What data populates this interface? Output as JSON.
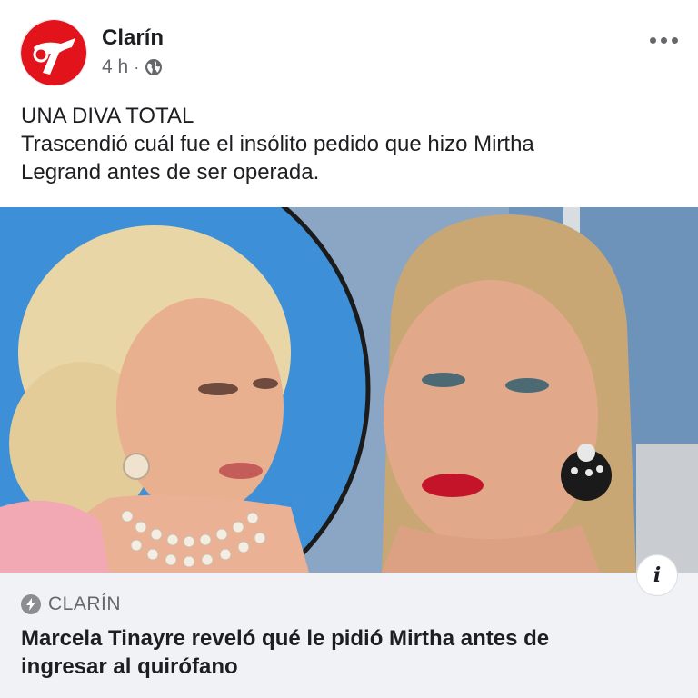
{
  "post": {
    "page_name": "Clarín",
    "time": "4 h",
    "separator": "·",
    "privacy_icon": "globe-icon",
    "more_icon": "more-options-icon",
    "text_lines": [
      "UNA DIVA TOTAL",
      "Trascendió cuál fue el insólito pedido que hizo Mirtha",
      "Legrand antes de ser operada."
    ]
  },
  "link_preview": {
    "source_icon": "instant-article-bolt-icon",
    "source": "CLARÍN",
    "headline_lines": [
      "Marcela Tinayre reveló qué le pidió Mirtha antes de",
      "ingresar al quirófano"
    ],
    "info_label": "i"
  },
  "colors": {
    "brand_red": "#e2131b",
    "text_primary": "#1c1e21",
    "text_secondary": "#65676b",
    "link_bg": "#f0f2f5"
  }
}
